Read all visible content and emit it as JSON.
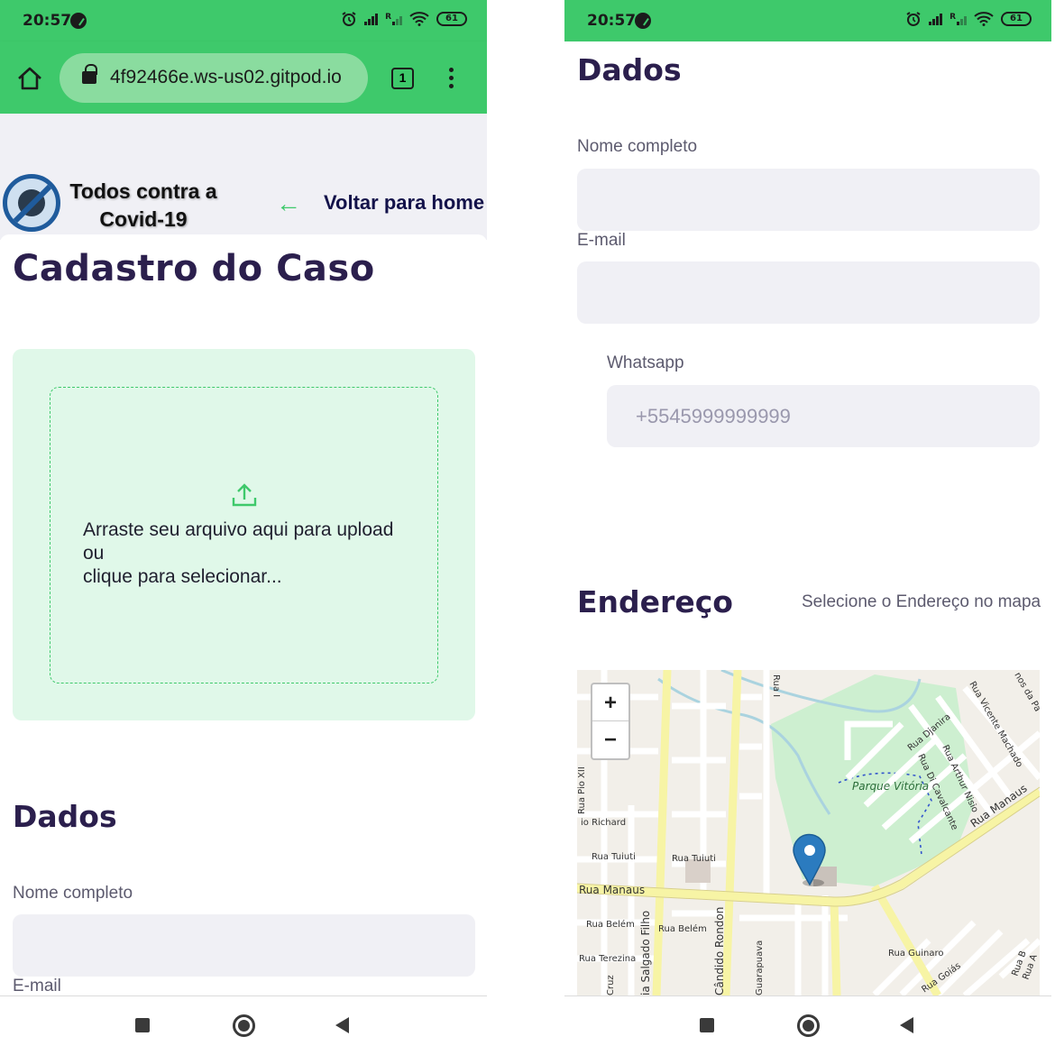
{
  "status": {
    "time": "20:57",
    "battery": "61",
    "signal2": "R"
  },
  "browser": {
    "url": "4f92466e.ws-us02.gitpod.io",
    "tab_count": "1"
  },
  "header": {
    "logo_text": "Todos contra a Covid-19",
    "back_label": "Voltar para home"
  },
  "page": {
    "title": "Cadastro do Caso"
  },
  "upload": {
    "line1": "Arraste seu arquivo aqui para upload",
    "line2": "ou",
    "line3": "clique para selecionar..."
  },
  "dados": {
    "title": "Dados",
    "nome_label": "Nome completo",
    "email_label": "E-mail",
    "whatsapp_label": "Whatsapp",
    "whatsapp_placeholder": "+5545999999999"
  },
  "endereco": {
    "title": "Endereço",
    "hint": "Selecione o Endereço no mapa",
    "map": {
      "zoom_in": "+",
      "zoom_out": "−",
      "park_label": "Parque Vitória",
      "streets": [
        "Rua Pio XII",
        "io Richard",
        "Rua Tuiuti",
        "Rua Tuiuti",
        "Rua Manaus",
        "Rua Belém",
        "Rua Belém",
        "Rua Terezina",
        "Cruz",
        "ia Salgado Filho",
        "Cândido Rondon",
        "Guarapuava",
        "Rua Djanira",
        "Rua Di Cavalcante",
        "Rua Arthur Nisio",
        "Rua Vicente Machado",
        "Rua Manaus",
        "Rua Guinaro",
        "Rua Goiás",
        "Rua B",
        "Rua A",
        "Rua I",
        "nos da Pá"
      ]
    }
  },
  "colors": {
    "brand_green": "#3ec96b",
    "title_purple": "#2b1f4d",
    "dropzone_bg": "#e0f8e9",
    "input_bg": "#f0f0f5",
    "marker_blue": "#2b7bbf"
  }
}
